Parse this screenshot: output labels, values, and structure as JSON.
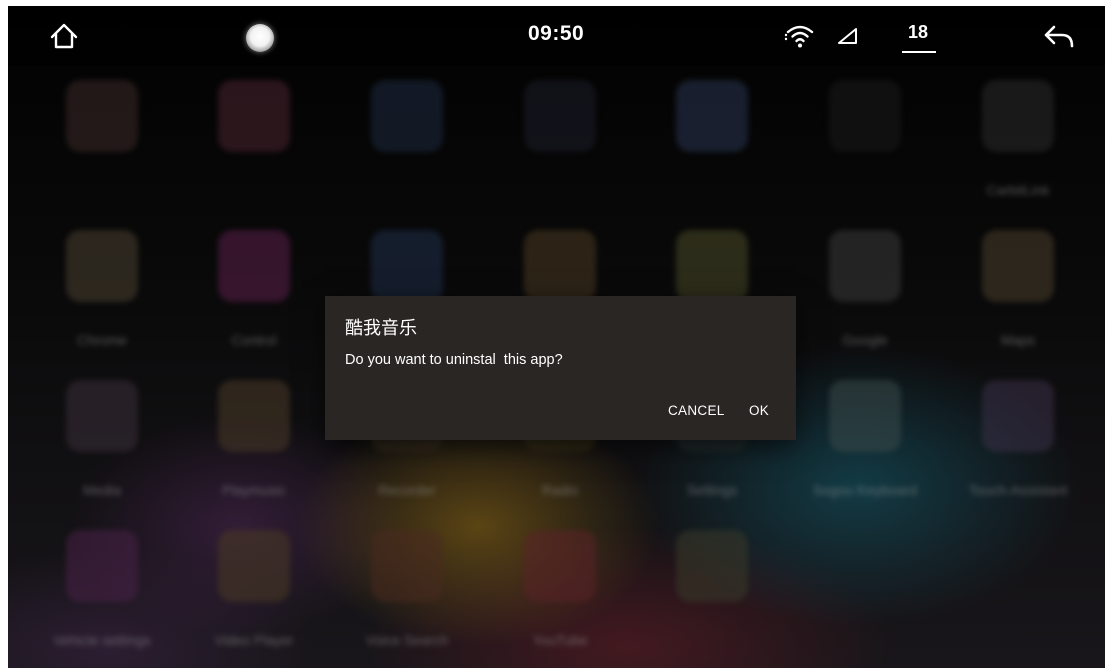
{
  "status_bar": {
    "time": "09:50",
    "notification_count": "18",
    "icons": [
      "home-icon",
      "camera-shutter-icon",
      "wifi-icon",
      "signal-icon",
      "back-arrow-icon"
    ]
  },
  "launcher": {
    "apps": [
      {
        "label": "",
        "color": "#3b2a28"
      },
      {
        "label": "",
        "color": "#4a2430"
      },
      {
        "label": "",
        "color": "#1e2a40"
      },
      {
        "label": "",
        "color": "#1c1c2a"
      },
      {
        "label": "",
        "color": "#2a3550"
      },
      {
        "label": "",
        "color": "#1a1a1a"
      },
      {
        "label": "CarbitLink",
        "color": "#2b2b2b"
      },
      {
        "label": "Chrome",
        "color": "#4a4030"
      },
      {
        "label": "Control",
        "color": "#5a1f4a"
      },
      {
        "label": "",
        "color": "#1f2f4a"
      },
      {
        "label": "",
        "color": "#4a3a22"
      },
      {
        "label": "",
        "color": "#4a4a28"
      },
      {
        "label": "Google",
        "color": "#3a3a3a"
      },
      {
        "label": "Maps",
        "color": "#4a3e2c"
      },
      {
        "label": "Media",
        "color": "#3a2e3a"
      },
      {
        "label": "Playmusic",
        "color": "#4a3a28"
      },
      {
        "label": "Recorder",
        "color": "#3a3020"
      },
      {
        "label": "Radio",
        "color": "#3a3218"
      },
      {
        "label": "Settings",
        "color": "#2a3030"
      },
      {
        "label": "Sogou Keyboard",
        "color": "#3a4a4a"
      },
      {
        "label": "Touch-Assistant",
        "color": "#3a3048"
      },
      {
        "label": "Vehicle settings",
        "color": "#4a2248"
      },
      {
        "label": "Video Player",
        "color": "#4a3a24"
      },
      {
        "label": "Voice Search",
        "color": "#4a2a20"
      },
      {
        "label": "YouTube",
        "color": "#5a2228"
      },
      {
        "label": "",
        "color": "#3a3a2a"
      }
    ]
  },
  "dialog": {
    "title": "酷我音乐",
    "message": "Do you want to uninstal  this app?",
    "cancel_label": "CANCEL",
    "ok_label": "OK",
    "background": "#2a2624"
  }
}
